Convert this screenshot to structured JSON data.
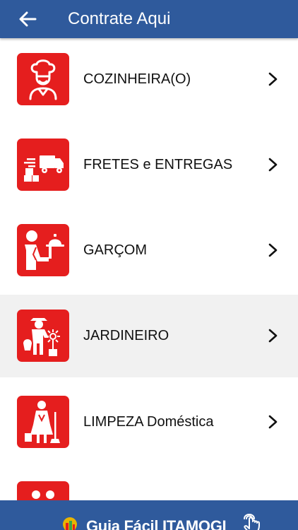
{
  "header": {
    "title": "Contrate Aqui",
    "back_icon": "arrow-left-icon"
  },
  "colors": {
    "header_bg": "#2f5a9c",
    "tile_red": "#e51e1e",
    "highlight_row": "#f1f1f1"
  },
  "items": [
    {
      "label": "COZINHEIRA(O)",
      "icon": "chef-icon"
    },
    {
      "label": "FRETES e ENTREGAS",
      "icon": "delivery-truck-icon"
    },
    {
      "label": "GARÇOM",
      "icon": "waiter-icon"
    },
    {
      "label": "JARDINEIRO",
      "icon": "gardener-icon"
    },
    {
      "label": "LIMPEZA Doméstica",
      "icon": "housekeeper-icon"
    },
    {
      "label": "",
      "icon": "people-icon"
    }
  ],
  "footer": {
    "brand_text": "Guia Fácil ITAMOGI",
    "touch_icon": "hand-touch-icon"
  }
}
